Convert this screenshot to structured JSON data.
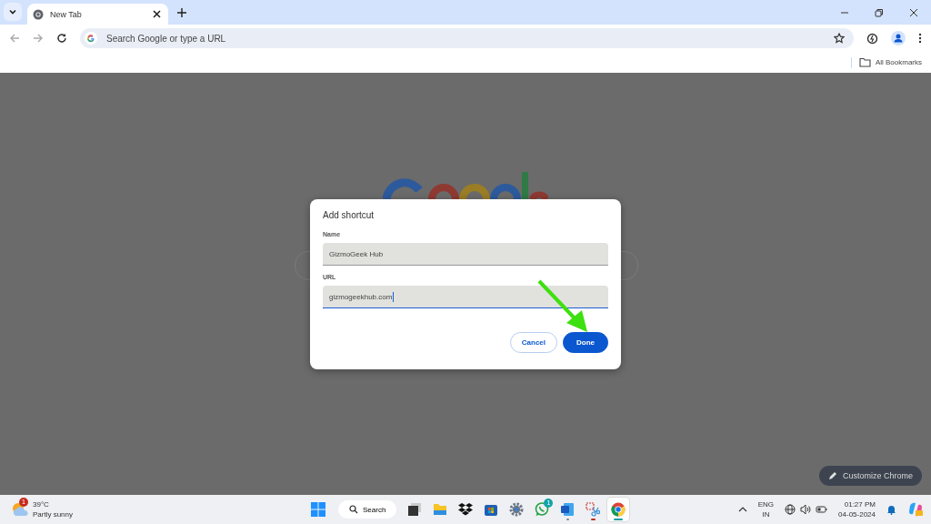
{
  "tabs": [
    {
      "title": "New Tab",
      "selected": true
    }
  ],
  "omnibox": {
    "placeholder": "Search Google or type a URL"
  },
  "bookmarks_bar": {
    "folder": "All Bookmarks"
  },
  "new_tab_page": {
    "customize_button": "Customize Chrome"
  },
  "dialog": {
    "title": "Add shortcut",
    "fields": [
      {
        "label": "Name",
        "value": "GizmoGeek Hub",
        "focused": false
      },
      {
        "label": "URL",
        "value": "gizmogeekhub.com",
        "focused": true
      }
    ],
    "buttons": [
      {
        "label": "Cancel",
        "kind": "secondary"
      },
      {
        "label": "Done",
        "kind": "primary"
      }
    ]
  },
  "taskbar": {
    "weather": {
      "badge": "1",
      "temperature": "39°C",
      "condition": "Partly sunny"
    },
    "search_label": "Search",
    "apps": [
      {
        "kind": "taskview",
        "running": false,
        "selected": false
      },
      {
        "kind": "explorer",
        "running": false,
        "selected": false
      },
      {
        "kind": "dropbox",
        "running": false,
        "selected": false
      },
      {
        "kind": "store",
        "running": false,
        "selected": false
      },
      {
        "kind": "settings",
        "running": false,
        "selected": false
      },
      {
        "kind": "whatsapp",
        "running": false,
        "selected": false,
        "badge": "1"
      },
      {
        "kind": "word",
        "running": true,
        "selected": false
      },
      {
        "kind": "snip",
        "running": true,
        "selected": false
      },
      {
        "kind": "chrome",
        "running": true,
        "selected": true
      }
    ],
    "language": [
      "ENG",
      "IN"
    ],
    "time": "01:27 PM",
    "date": "04-05-2024"
  }
}
